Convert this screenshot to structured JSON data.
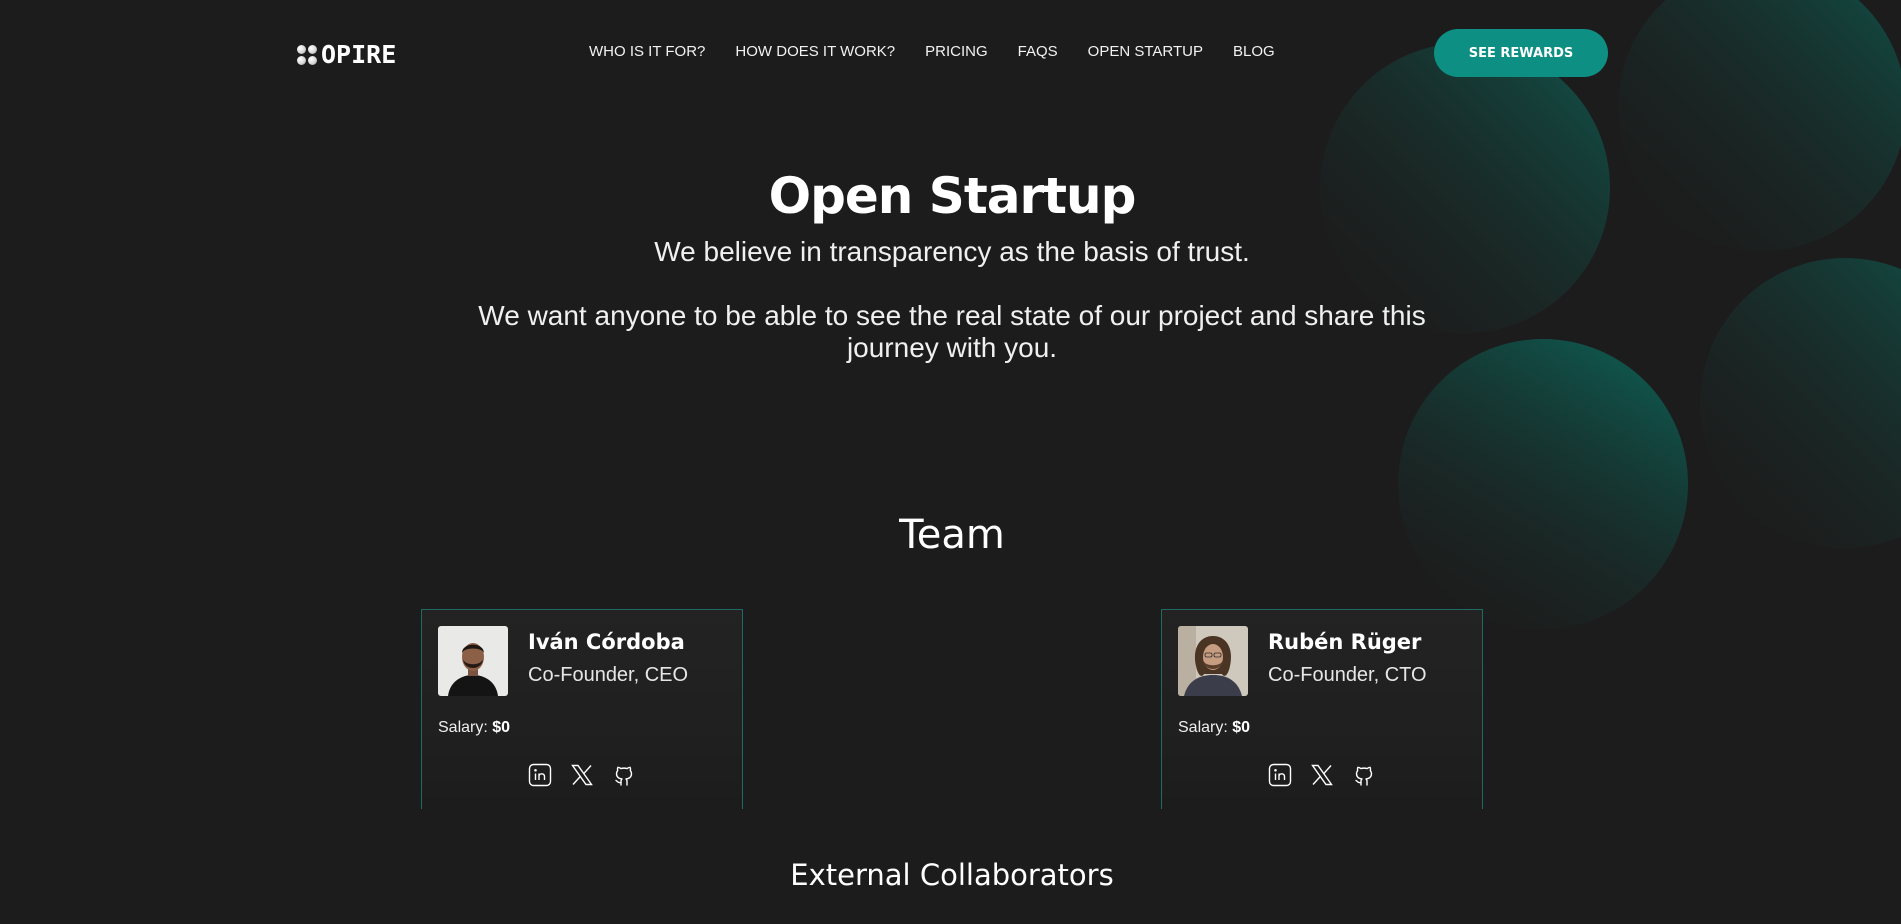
{
  "brand": {
    "logo_text": "OPIRE",
    "accent_color": "#0e8f83"
  },
  "nav": {
    "links": [
      {
        "label": "WHO IS IT FOR?"
      },
      {
        "label": "HOW DOES IT WORK?"
      },
      {
        "label": "PRICING"
      },
      {
        "label": "FAQS"
      },
      {
        "label": "OPEN STARTUP"
      },
      {
        "label": "BLOG"
      }
    ],
    "cta_label": "SEE REWARDS"
  },
  "hero": {
    "title": "Open Startup",
    "paragraph_1": "We believe in transparency as the basis of trust.",
    "paragraph_2": "We want anyone to be able to see the real state of our project and share this journey with you."
  },
  "team": {
    "title": "Team",
    "members": [
      {
        "name": "Iván Córdoba",
        "role": "Co-Founder, CEO",
        "salary_label": "Salary:",
        "salary_value": "$0",
        "socials": [
          "linkedin-icon",
          "x-icon",
          "github-icon"
        ]
      },
      {
        "name": "Rubén Rüger",
        "role": "Co-Founder, CTO",
        "salary_label": "Salary:",
        "salary_value": "$0",
        "socials": [
          "linkedin-icon",
          "x-icon",
          "github-icon"
        ]
      }
    ]
  },
  "external": {
    "title": "External Collaborators"
  }
}
